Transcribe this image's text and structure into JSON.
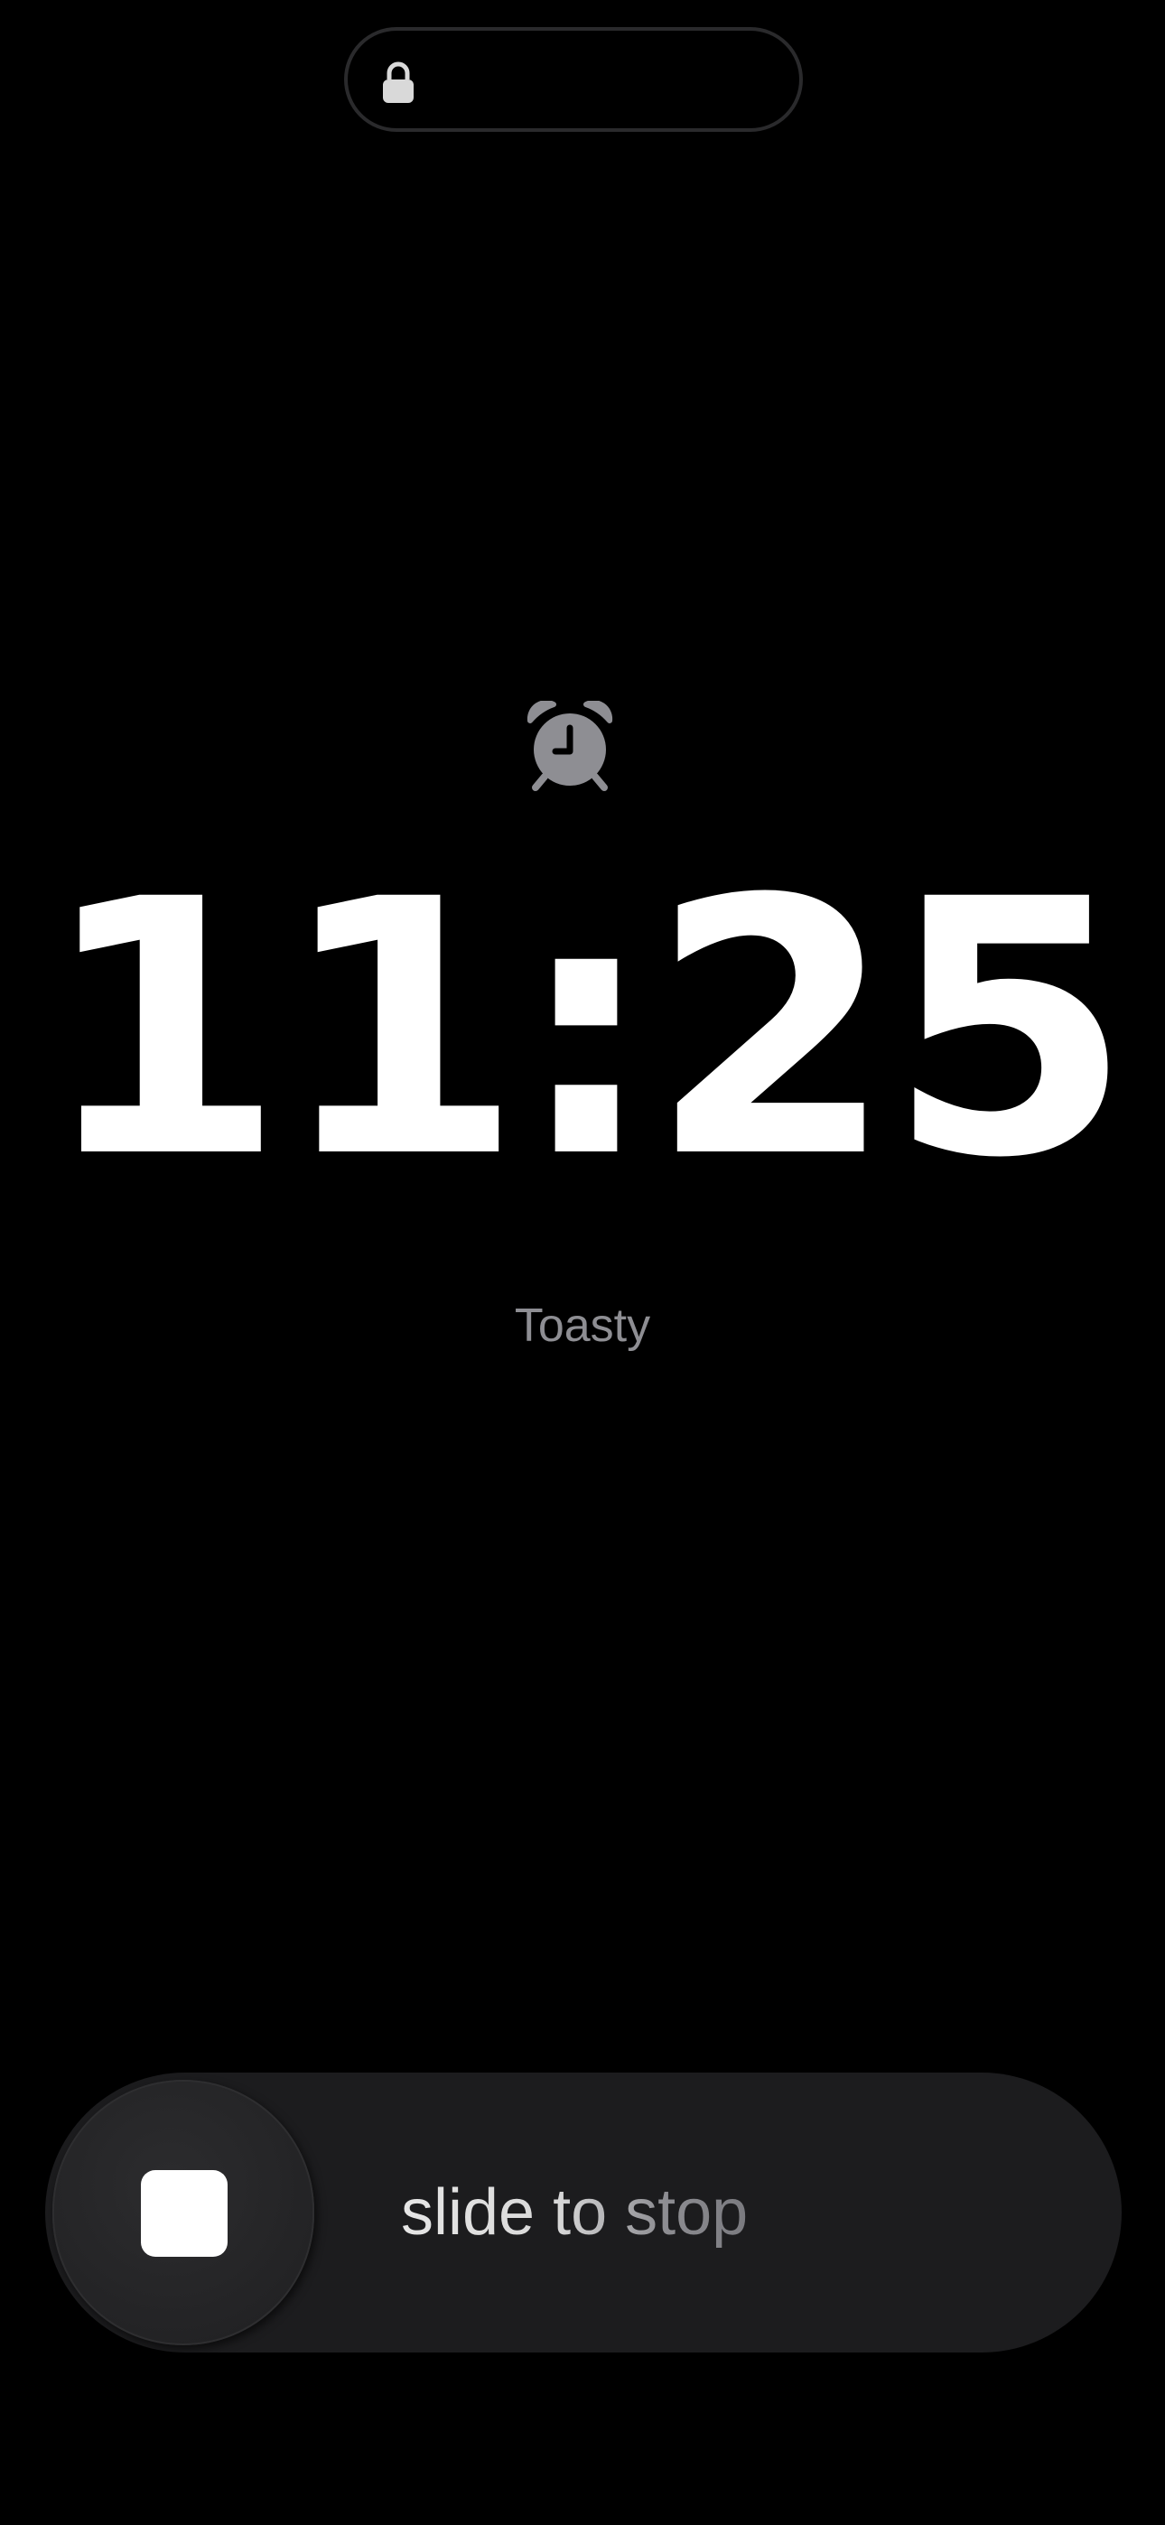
{
  "status": {
    "lock_icon": "lock-icon"
  },
  "alarm": {
    "icon": "alarm-clock-icon",
    "time": "11:25",
    "label": "Toasty"
  },
  "slider": {
    "label": "slide to stop",
    "knob_icon": "stop-icon"
  },
  "colors": {
    "background": "#000000",
    "time_text": "#ffffff",
    "secondary_text": "#8e8e93",
    "slider_track": "#1c1c1e"
  }
}
